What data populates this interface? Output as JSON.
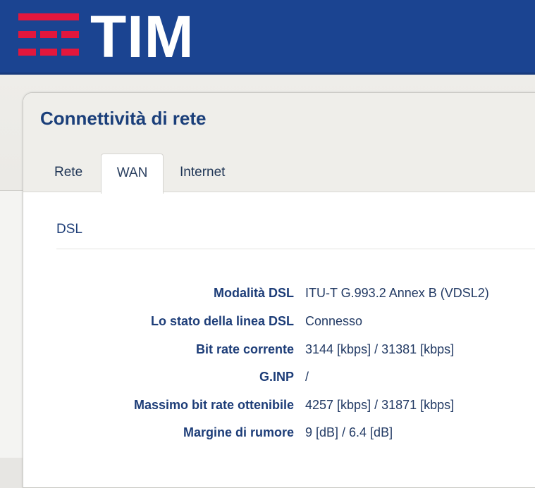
{
  "brand": {
    "name": "TIM",
    "header_color": "#1b4491",
    "accent_red": "#e2173d"
  },
  "page": {
    "title": "Connettività di rete"
  },
  "tabs": [
    {
      "label": "Rete",
      "active": false
    },
    {
      "label": "WAN",
      "active": true
    },
    {
      "label": "Internet",
      "active": false
    }
  ],
  "section": {
    "title": "DSL"
  },
  "rows": [
    {
      "label": "Modalità DSL",
      "value": "ITU-T G.993.2 Annex B (VDSL2)"
    },
    {
      "label": "Lo stato della linea DSL",
      "value": "Connesso"
    },
    {
      "label": "Bit rate corrente",
      "value": "3144 [kbps] / 31381 [kbps]"
    },
    {
      "label": "G.INP",
      "value": "/"
    },
    {
      "label": "Massimo bit rate ottenibile",
      "value": "4257 [kbps] / 31871 [kbps]"
    },
    {
      "label": "Margine di rumore",
      "value": "9 [dB] / 6.4 [dB]"
    }
  ]
}
